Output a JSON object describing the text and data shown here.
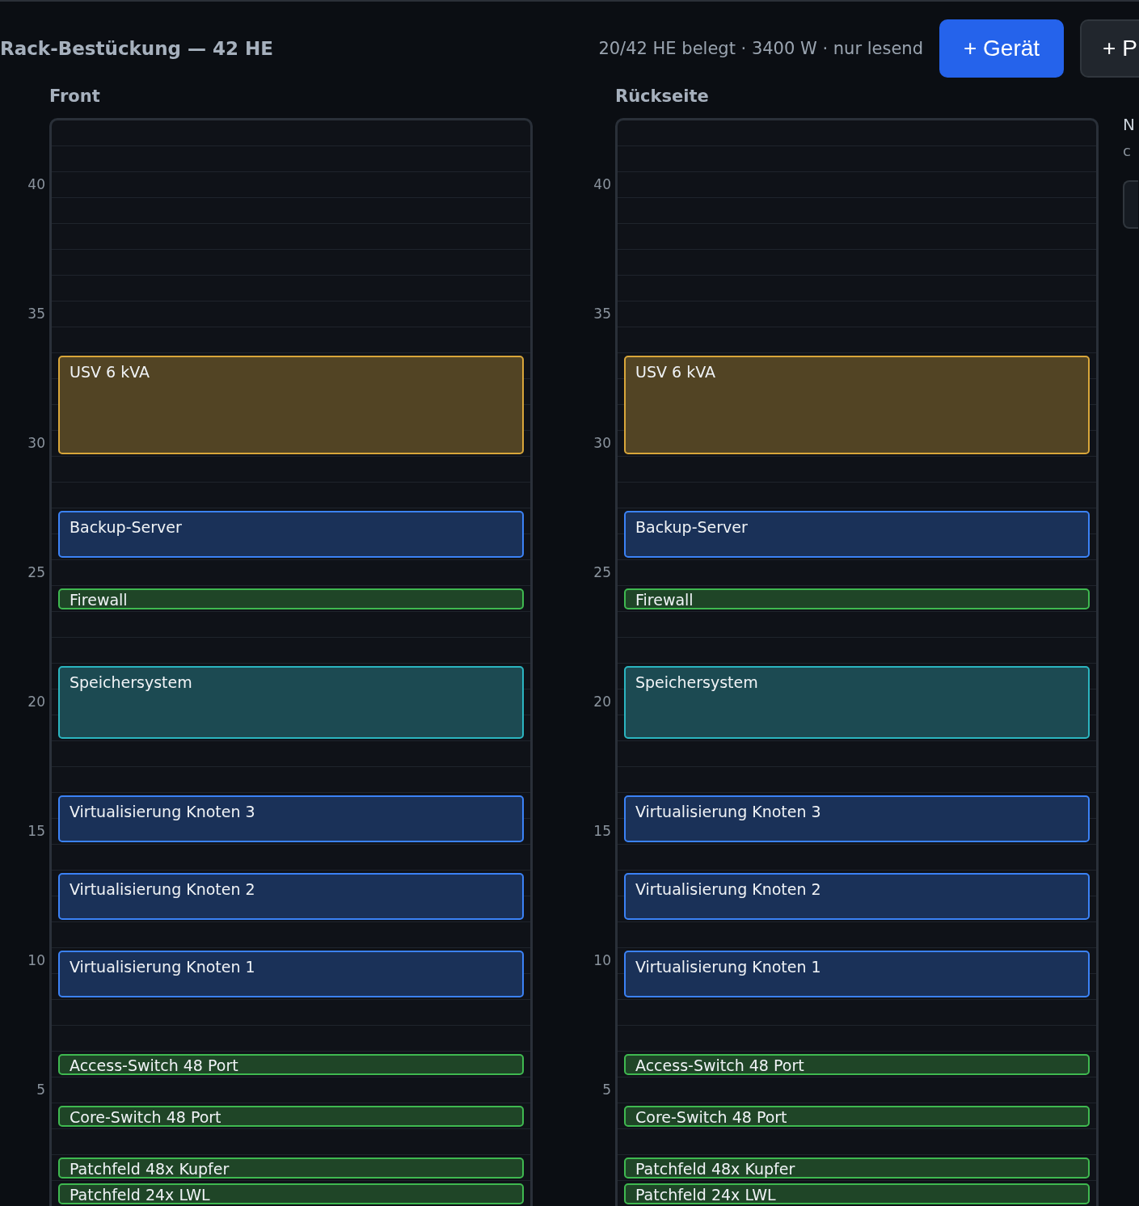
{
  "header": {
    "title": "Rack-Bestückung — 42 HE",
    "stats": "20/42 HE belegt · 3400 W · nur lesend",
    "buttons": [
      {
        "label": "+ Gerät",
        "kind": "primary"
      },
      {
        "label": "+ P",
        "kind": "secondary"
      }
    ]
  },
  "racks": [
    {
      "title": "Front",
      "scale": [
        "40",
        "35",
        "30",
        "25",
        "20",
        "15",
        "10",
        "5"
      ],
      "slots": [
        {
          "kind": "empty"
        },
        {
          "kind": "empty"
        },
        {
          "kind": "empty"
        },
        {
          "kind": "empty"
        },
        {
          "kind": "empty"
        },
        {
          "kind": "empty"
        },
        {
          "kind": "empty"
        },
        {
          "kind": "empty"
        },
        {
          "kind": "empty"
        },
        {
          "kind": "ups",
          "name": "USV 6 kVA"
        },
        {
          "kind": "empty"
        },
        {
          "kind": "empty"
        },
        {
          "kind": "server",
          "name": "Backup-Server"
        },
        {
          "kind": "empty"
        },
        {
          "kind": "network",
          "name": "Firewall"
        },
        {
          "kind": "empty"
        },
        {
          "kind": "empty"
        },
        {
          "kind": "storage",
          "name": "Speichersystem"
        },
        {
          "kind": "empty"
        },
        {
          "kind": "empty"
        },
        {
          "kind": "server",
          "name": "Virtualisierung Knoten 3"
        },
        {
          "kind": "empty"
        },
        {
          "kind": "server",
          "name": "Virtualisierung Knoten 2"
        },
        {
          "kind": "empty"
        },
        {
          "kind": "server",
          "name": "Virtualisierung Knoten 1"
        },
        {
          "kind": "empty"
        },
        {
          "kind": "empty"
        },
        {
          "kind": "network",
          "name": "Access-Switch 48 Port"
        },
        {
          "kind": "empty"
        },
        {
          "kind": "network",
          "name": "Core-Switch 48 Port"
        },
        {
          "kind": "empty"
        },
        {
          "kind": "network",
          "name": "Patchfeld 48x Kupfer"
        },
        {
          "kind": "network",
          "name": "Patchfeld 24x LWL"
        }
      ]
    },
    {
      "title": "Rückseite",
      "scale": [
        "40",
        "35",
        "30",
        "25",
        "20",
        "15",
        "10",
        "5"
      ],
      "slots": [
        {
          "kind": "empty"
        },
        {
          "kind": "empty"
        },
        {
          "kind": "empty"
        },
        {
          "kind": "empty"
        },
        {
          "kind": "empty"
        },
        {
          "kind": "empty"
        },
        {
          "kind": "empty"
        },
        {
          "kind": "empty"
        },
        {
          "kind": "empty"
        },
        {
          "kind": "ups",
          "name": "USV 6 kVA"
        },
        {
          "kind": "empty"
        },
        {
          "kind": "empty"
        },
        {
          "kind": "server",
          "name": "Backup-Server"
        },
        {
          "kind": "empty"
        },
        {
          "kind": "network",
          "name": "Firewall"
        },
        {
          "kind": "empty"
        },
        {
          "kind": "empty"
        },
        {
          "kind": "storage",
          "name": "Speichersystem"
        },
        {
          "kind": "empty"
        },
        {
          "kind": "empty"
        },
        {
          "kind": "server",
          "name": "Virtualisierung Knoten 3"
        },
        {
          "kind": "empty"
        },
        {
          "kind": "server",
          "name": "Virtualisierung Knoten 2"
        },
        {
          "kind": "empty"
        },
        {
          "kind": "server",
          "name": "Virtualisierung Knoten 1"
        },
        {
          "kind": "empty"
        },
        {
          "kind": "empty"
        },
        {
          "kind": "network",
          "name": "Access-Switch 48 Port"
        },
        {
          "kind": "empty"
        },
        {
          "kind": "network",
          "name": "Core-Switch 48 Port"
        },
        {
          "kind": "empty"
        },
        {
          "kind": "network",
          "name": "Patchfeld 48x Kupfer"
        },
        {
          "kind": "network",
          "name": "Patchfeld 24x LWL"
        }
      ]
    }
  ],
  "side_panel": {
    "title": "N",
    "subtitle": "c"
  }
}
